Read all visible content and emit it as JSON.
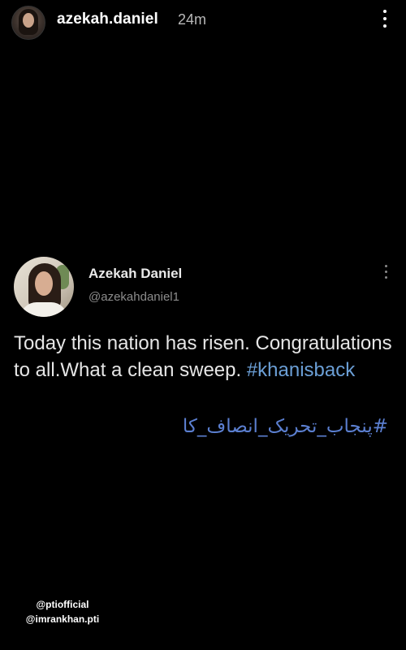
{
  "story": {
    "username": "azekah.daniel",
    "time_ago": "24m",
    "avatar_icon": "profile-photo",
    "more_icon": "vertical-ellipsis-icon"
  },
  "tweet": {
    "display_name": "Azekah Daniel",
    "handle": "@azekahdaniel1",
    "text_line": "Today this nation has risen. Congratulations to all.What a clean sweep.",
    "hashtag": "#khanisback",
    "urdu_hashtag": "#پنجاب_تحریک_انصاف_کا",
    "hashtag_color": "#6b9fd6",
    "more_icon": "vertical-ellipsis-icon"
  },
  "mentions": [
    "@ptiofficial",
    "@imrankhan.pti"
  ]
}
